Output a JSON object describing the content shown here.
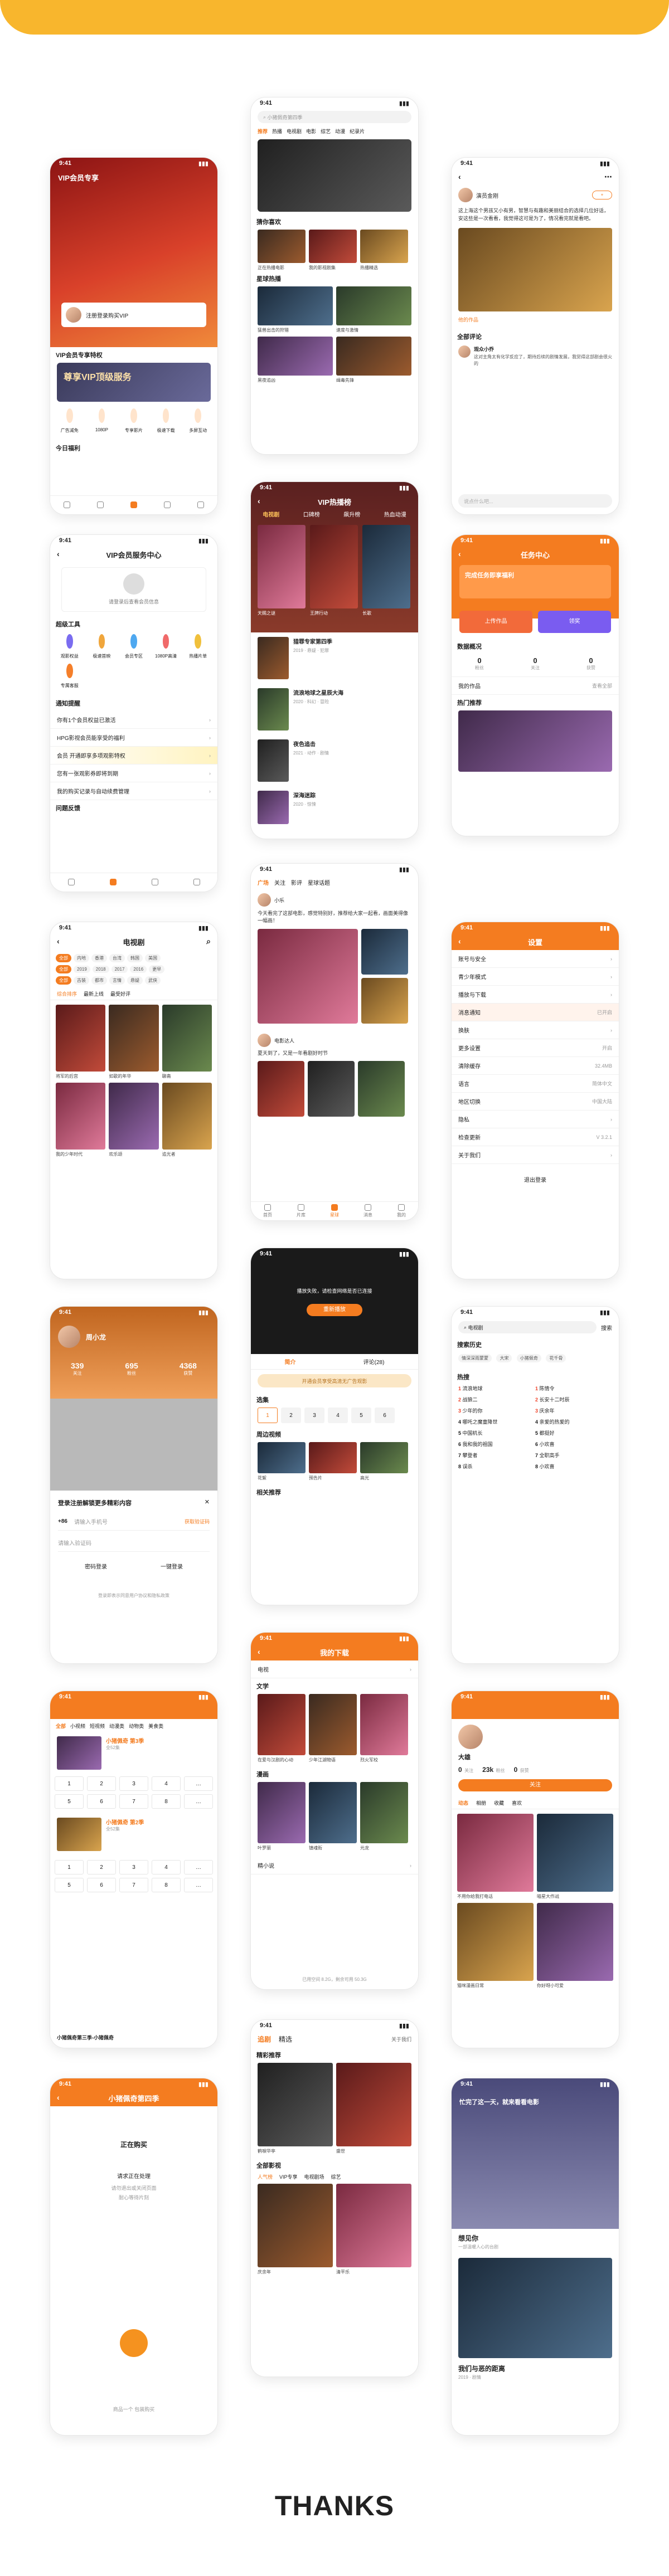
{
  "status_time": "9:41",
  "thanks": "THANKS",
  "s1": {
    "nav_title": "VIP会员专享",
    "user_name": "注册登录购买VIP",
    "vip_area_title": "VIP会员专享特权",
    "banner_title": "尊享VIP顶级服务",
    "icons": [
      "广告减免",
      "1080P",
      "专享影片",
      "极速下载",
      "多屏互动"
    ],
    "section_title": "今日福利"
  },
  "s2": {
    "search_placeholder": "小猪佩奇第四季",
    "tabs": [
      "推荐",
      "热播",
      "电视剧",
      "电影",
      "综艺",
      "动漫",
      "纪录片"
    ],
    "section1": "猜你喜欢",
    "items1": [
      "正在热播电影",
      "我的影视剧集",
      "热播精选"
    ],
    "section2": "星球热播",
    "items2": [
      "猛兽出击的狩猎",
      "速度与激情",
      "黑夜追凶",
      "缉毒先锋"
    ]
  },
  "s3": {
    "poster_name": "演员金刚",
    "post_text": "这上海这个男孩又小有男，智慧与有趣和美丽结合的选择几位好话，安这些是一次看看，我觉得这可是为了，情况看完就是看吧。",
    "poster_label": "他的作品",
    "comments_title": "全部评论",
    "comment1_user": "观众小乔",
    "comment1_text": "这对主角太有化学反应了，期待后续的剧情发展，我觉得这部剧会很火的",
    "input_placeholder": "说点什么吧..."
  },
  "s4": {
    "nav_title": "VIP会员服务中心",
    "login_hint": "请登录后查看会员信息",
    "tools_title": "超级工具",
    "tools": [
      "观影权益",
      "极速首映",
      "会员专区",
      "1080P高清",
      "热播片单",
      "专属客服"
    ],
    "notices_title": "通知提醒",
    "notices": [
      "你有1个会员权益已激活",
      "HPG影视会员能享受的福利",
      "会员 开通即享多项观影特权",
      "您有一张观影券即将到期",
      "我的购买记录与自动续费管理"
    ],
    "more_label": "问题反馈"
  },
  "s5": {
    "nav_title": "VIP热播榜",
    "tabs": [
      "电视剧",
      "口碑榜",
      "飙升榜",
      "热血动漫"
    ],
    "banner_items": [
      "天赐之谜",
      "王牌行动",
      "长歌"
    ],
    "list": [
      {
        "title": "猎罪专家第四季",
        "meta": "2019 · 悬疑 · 犯罪"
      },
      {
        "title": "流浪地球之星辰大海",
        "meta": "2020 · 科幻 · 冒险"
      },
      {
        "title": "夜色追击",
        "meta": "2021 · 动作 · 剧情"
      },
      {
        "title": "深海迷踪",
        "meta": "2020 · 惊悚"
      }
    ]
  },
  "s6": {
    "nav_title": "任务中心",
    "banner_text": "完成任务即享福利",
    "btn1": "上传作品",
    "btn2": "领奖",
    "stats_title": "数据概况",
    "stats": [
      {
        "value": "0",
        "label": "粉丝"
      },
      {
        "value": "0",
        "label": "关注"
      },
      {
        "value": "0",
        "label": "获赞"
      }
    ],
    "works_title": "我的作品",
    "works_more": "查看全部",
    "hot_title": "热门推荐"
  },
  "s7": {
    "tabs": [
      "广场",
      "关注",
      "影评",
      "星球话题"
    ],
    "user1": "小乐",
    "post1": "今天看完了这部电影，感觉特别好，推荐给大家一起看，画面美得像一幅画！",
    "user2": "电影达人",
    "post2": "夏天到了，又是一年看剧好时节",
    "tab_labels": [
      "首页",
      "片库",
      "星球",
      "消息",
      "我的"
    ]
  },
  "s8": {
    "nav_title": "电视剧",
    "filter_rows": [
      [
        "全部",
        "内地",
        "香港",
        "台湾",
        "韩国",
        "美国"
      ],
      [
        "全部",
        "2019",
        "2018",
        "2017",
        "2016",
        "更早"
      ],
      [
        "全部",
        "古装",
        "都市",
        "言情",
        "悬疑",
        "武侠"
      ]
    ],
    "sort_tabs": [
      "综合排序",
      "最新上线",
      "最受好评"
    ],
    "items": [
      "将军的后宫",
      "如歌的年华",
      "聊斋",
      "我的少年时代",
      "欢乐颂",
      "追光者"
    ]
  },
  "s9": {
    "notice": "播放失败，请检查网络是否已连接",
    "retry_label": "重新播放",
    "tabs": [
      "简介",
      "评论(28)"
    ],
    "promo": "开通会员享受高清无广告观影",
    "series_title": "选集",
    "episodes": [
      "1",
      "2",
      "3",
      "4",
      "5",
      "6"
    ],
    "related_title": "周边视频",
    "related": [
      "花絮",
      "预告片",
      "高光"
    ],
    "recommend_title": "相关推荐"
  },
  "s10": {
    "nav_title": "设置",
    "items": [
      {
        "label": "账号与安全",
        "value": ""
      },
      {
        "label": "青少年模式",
        "value": ""
      },
      {
        "label": "播放与下载",
        "value": ""
      },
      {
        "label": "消息通知",
        "value": "已开启"
      },
      {
        "label": "换肤",
        "value": ""
      },
      {
        "label": "更多设置",
        "value": "开启"
      },
      {
        "label": "清除缓存",
        "value": "32.4MB"
      },
      {
        "label": "语言",
        "value": "简体中文"
      },
      {
        "label": "地区切换",
        "value": "中国大陆"
      },
      {
        "label": "隐私",
        "value": ""
      },
      {
        "label": "检查更新",
        "value": "V 3.2.1"
      },
      {
        "label": "关于我们",
        "value": ""
      }
    ],
    "logout_label": "退出登录"
  },
  "s11": {
    "user_name": "周小龙",
    "stats": [
      {
        "value": "339",
        "label": "关注"
      },
      {
        "value": "695",
        "label": "粉丝"
      },
      {
        "value": "4368",
        "label": "获赞"
      }
    ],
    "sheet_title": "登录注册解锁更多精彩内容",
    "phone_prefix": "+86",
    "phone_placeholder": "请输入手机号",
    "code_label": "获取验证码",
    "code_placeholder": "请输入验证码",
    "pwd_login": "密码登录",
    "quick_login": "一键登录",
    "agree": "登录即表示同意用户协议和隐私政策"
  },
  "s12": {
    "search_placeholder": "电视剧",
    "search_btn": "搜索",
    "history_title": "搜索历史",
    "history": [
      "情深深雨蒙蒙",
      "大宋",
      "小猪佩奇",
      "花千骨"
    ],
    "hot_title": "热搜",
    "hot_left": [
      "流浪地球",
      "战狼二",
      "少年的你",
      "哪吒之魔童降世",
      "中国机长",
      "我和我的祖国",
      "攀登者",
      "误杀"
    ],
    "hot_right": [
      "陈情令",
      "长安十二时辰",
      "庆余年",
      "亲爱的热爱的",
      "都挺好",
      "小欢喜",
      "全职高手",
      "小欢喜"
    ]
  },
  "s13": {
    "nav_title": "我的下载",
    "section1": "电视",
    "section2": "文学",
    "items2": [
      "在爱与汉剧的心动",
      "少年江湖物语",
      "烈火军校"
    ],
    "section3": "漫画",
    "items3": [
      "叶罗丽",
      "镇魂街",
      "元龙"
    ],
    "section4": "精小说",
    "storage": "已用空间 8.2G，剩余可用 50.3G"
  },
  "s14": {
    "tabs": [
      "全部",
      "小视频",
      "短视频",
      "动漫类",
      "动物类",
      "美食类"
    ],
    "item1_title": "小猪佩奇 第3季",
    "item1_meta": "全52集",
    "item2_title": "小猪佩奇 第2季",
    "item2_meta": "全52集",
    "episodes": [
      "1",
      "2",
      "3",
      "4",
      "…",
      "5",
      "6",
      "7",
      "8",
      "…"
    ],
    "footer": "小猪佩奇第三季-小猪佩奇"
  },
  "s15": {
    "user_name": "大雄",
    "stats": [
      {
        "value": "0",
        "label": "关注"
      },
      {
        "value": "23k",
        "label": "粉丝"
      },
      {
        "value": "0",
        "label": "获赞"
      }
    ],
    "follow_label": "关注",
    "tabs": [
      "动态",
      "相册",
      "收藏",
      "喜欢"
    ],
    "captions": [
      "不用你给我打电话",
      "喵星大作战",
      "猫咪漫画日常",
      "你好呀小可爱"
    ]
  },
  "s16": {
    "nav_title": "小猪佩奇第四季",
    "loading": "正在购买",
    "tips_title": "请求正在处理",
    "tips": [
      "请勿退出或关闭页面",
      "耐心等待片刻"
    ],
    "footer": "商品一个 包装购买"
  },
  "s17": {
    "tabs": [
      "追剧",
      "精选"
    ],
    "header_right": "关于我们",
    "section1": "精彩推荐",
    "section2": "全部影视",
    "filter_tabs": [
      "人气榜",
      "VIP专享",
      "电视剧场",
      "综艺"
    ],
    "posters": [
      "鹤唳华亭",
      "盛世",
      "庆余年",
      "清平乐"
    ]
  },
  "s18": {
    "banner_text": "忙完了这一天，就来看看电影",
    "item1_title": "想见你",
    "item1_meta": "一部温暖人心的台剧",
    "item2_title": "我们与恶的距离",
    "item2_meta": "2019 · 剧情"
  }
}
